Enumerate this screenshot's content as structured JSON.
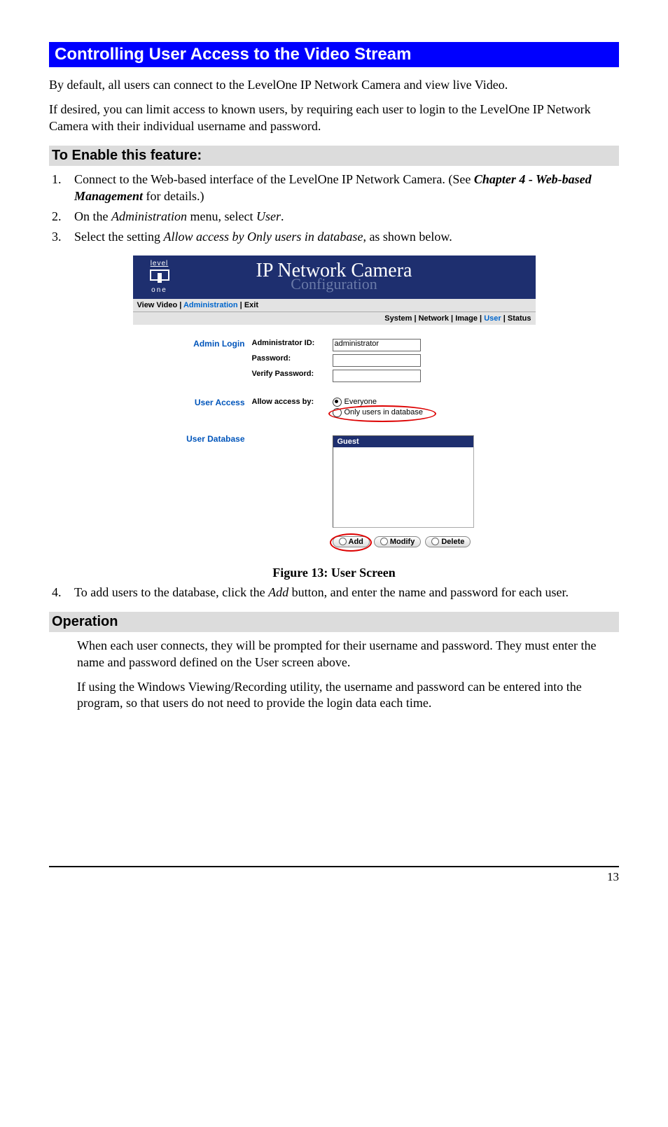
{
  "heading_main": "Controlling User Access to the Video Stream",
  "intro1": "By default, all users can connect to the LevelOne IP Network Camera and view live Video.",
  "intro2": "If desired, you can limit access to known users, by requiring each user to login to the LevelOne IP Network Camera with their individual username and password.",
  "heading_enable": "To Enable this feature:",
  "steps": {
    "s1a": "Connect to the Web-based interface of the LevelOne IP Network Camera. (See ",
    "s1b": "Chapter 4 - Web-based Management",
    "s1c": " for details.)",
    "s2a": "On the ",
    "s2b": "Administration",
    "s2c": " menu, select ",
    "s2d": "User",
    "s2e": ".",
    "s3a": "Select the setting ",
    "s3b": "Allow access by Only users in database",
    "s3c": ", as shown below.",
    "s4a": "To add users to the database, click the ",
    "s4b": "Add",
    "s4c": " button, and enter the name and password for each user."
  },
  "figure_caption": "Figure 13: User Screen",
  "heading_operation": "Operation",
  "op1": "When each user connects, they will be prompted for their username and password. They must enter the name and password defined on the User screen above.",
  "op2": "If using the Windows Viewing/Recording utility, the username and password can be entered into the program, so that users do not need to provide the login data each time.",
  "page_number": "13",
  "screenshot": {
    "logo_top": "level",
    "logo_bot": "one",
    "title_main": "IP Network Camera",
    "title_sub": "Configuration",
    "topnav": {
      "view": "View Video",
      "admin": "Administration",
      "exit": "Exit",
      "sep": " | "
    },
    "subnav": {
      "system": "System",
      "network": "Network",
      "image": "Image",
      "user": "User",
      "status": "Status",
      "sep": " | "
    },
    "sections": {
      "admin_login": "Admin Login",
      "user_access": "User Access",
      "user_database": "User Database"
    },
    "labels": {
      "admin_id": "Administrator ID:",
      "password": "Password:",
      "verify_password": "Verify Password:",
      "allow_access_by": "Allow access by:"
    },
    "values": {
      "admin_id": "administrator"
    },
    "radios": {
      "everyone": "Everyone",
      "only_db": "Only users in database"
    },
    "listbox_header": "Guest",
    "buttons": {
      "add": "Add",
      "modify": "Modify",
      "delete": "Delete"
    }
  }
}
